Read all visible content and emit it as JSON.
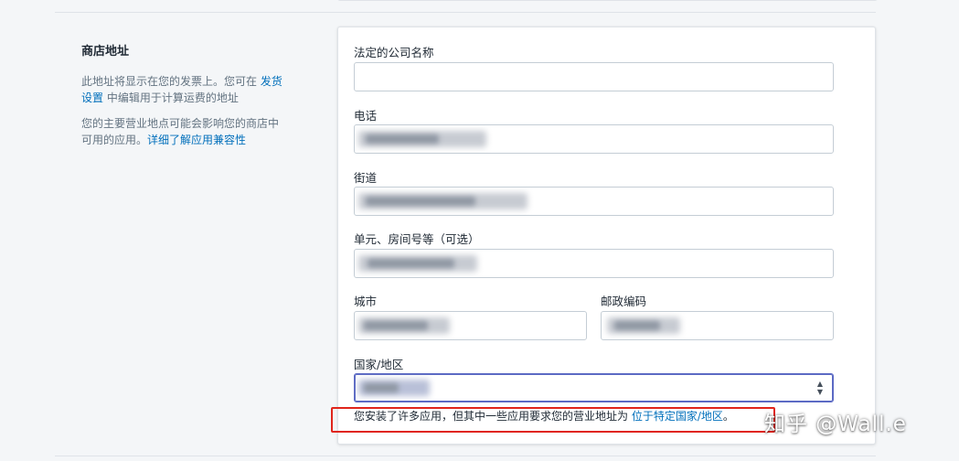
{
  "section": {
    "title": "商店地址",
    "desc1_text": "此地址将显示在您的发票上。您可在 ",
    "desc1_link": "发货设置",
    "desc1_text2": " 中编辑用于计算运费的地址",
    "desc2_text": "您的主要营业地点可能会影响您的商店中可用的应用。",
    "desc2_link": "详细了解应用兼容性"
  },
  "form": {
    "company_label": "法定的公司名称",
    "company_value": "",
    "phone_label": "电话",
    "street_label": "街道",
    "unit_label": "单元、房间号等（可选）",
    "city_label": "城市",
    "postal_label": "邮政编码",
    "country_label": "国家/地区"
  },
  "notice": {
    "text": "您安装了许多应用，但其中一些应用要求您的营业地址为 ",
    "link": "位于特定国家/地区",
    "end": "。"
  },
  "watermark": "知乎 @Wall.e",
  "colors": {
    "link": "#006fbb",
    "highlight_box": "#e0251b",
    "focus_border": "#5c6ac4"
  }
}
